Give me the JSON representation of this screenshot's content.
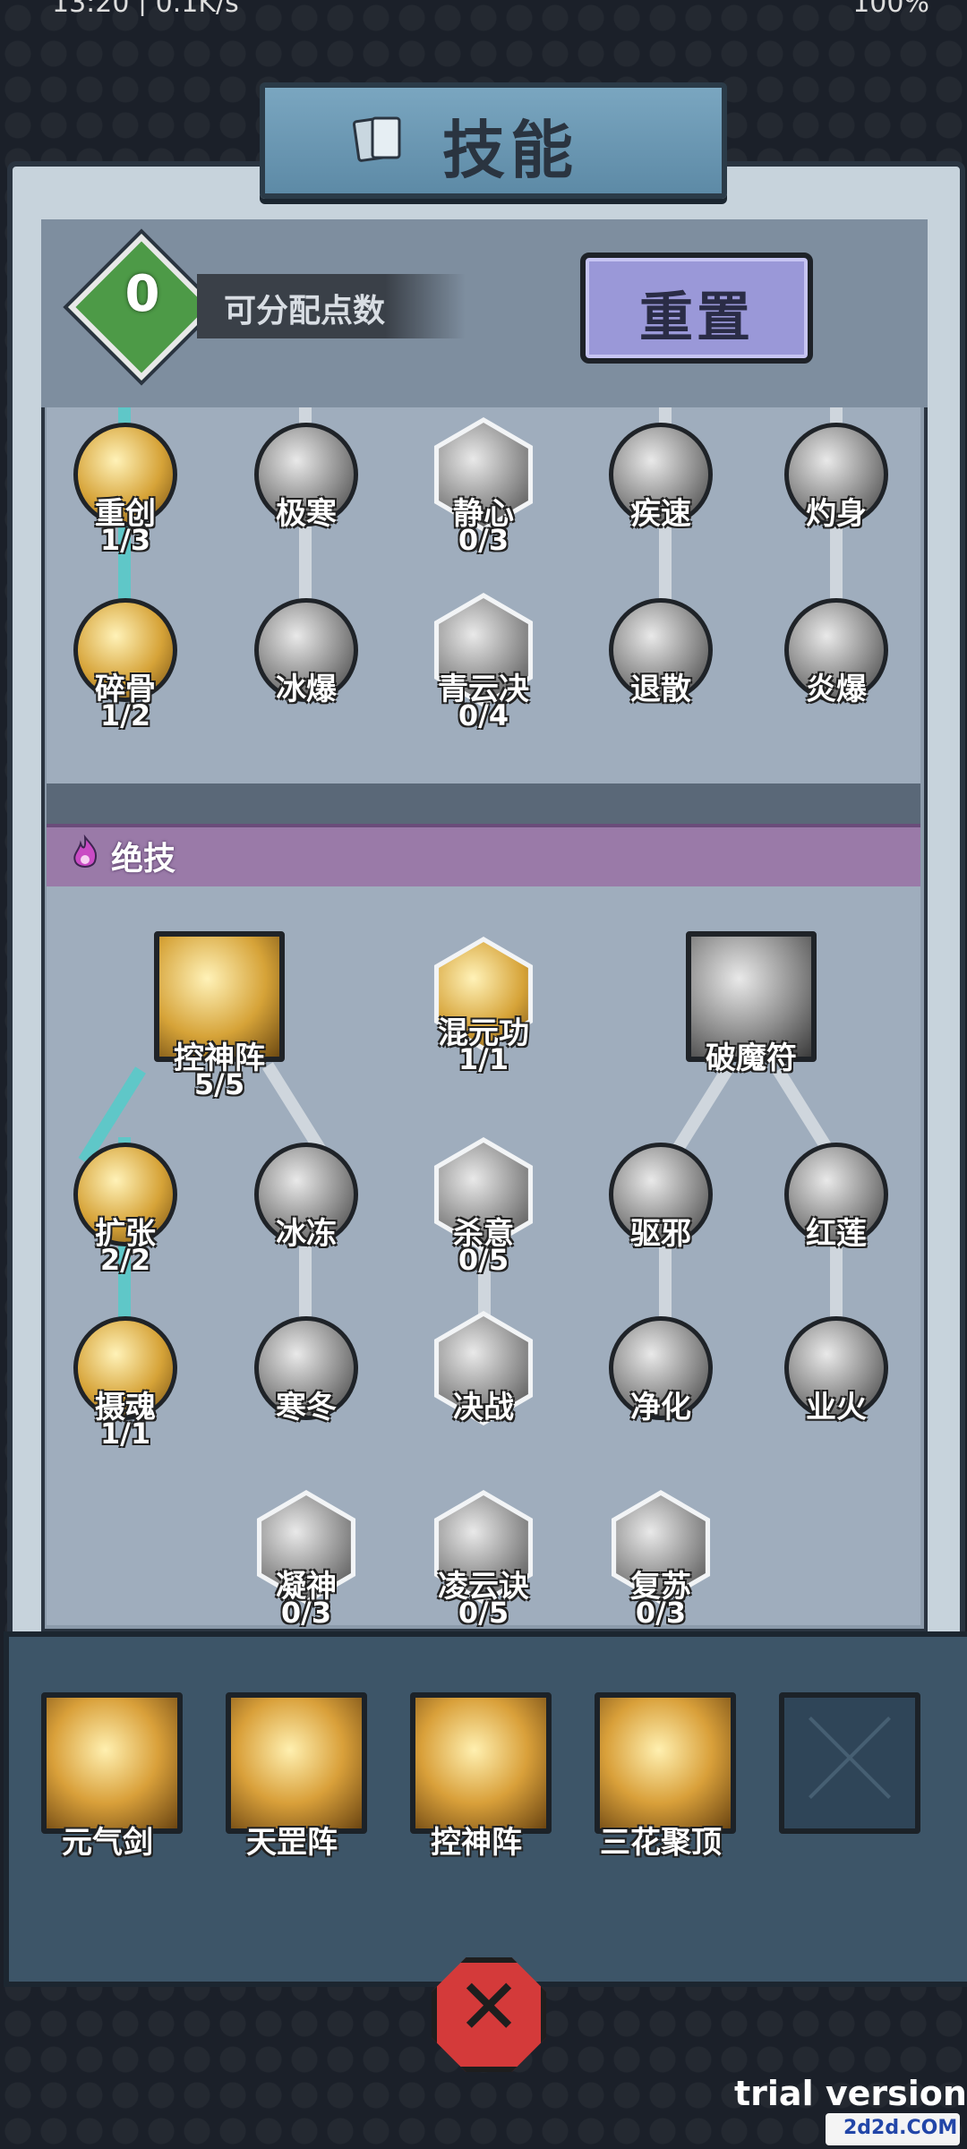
{
  "status_bar": {
    "left": "13:20 | 0.1K/s",
    "right": "100%"
  },
  "header": {
    "title": "技能"
  },
  "points": {
    "value": "0",
    "label": "可分配点数"
  },
  "reset_button": {
    "label": "重置"
  },
  "basic_skills": [
    {
      "name": "重创",
      "level": "1/3"
    },
    {
      "name": "极寒",
      "level": ""
    },
    {
      "name": "静心",
      "level": "0/3"
    },
    {
      "name": "疾速",
      "level": ""
    },
    {
      "name": "灼身",
      "level": ""
    },
    {
      "name": "碎骨",
      "level": "1/2"
    },
    {
      "name": "冰爆",
      "level": ""
    },
    {
      "name": "青云决",
      "level": "0/4"
    },
    {
      "name": "退散",
      "level": ""
    },
    {
      "name": "炎爆",
      "level": ""
    }
  ],
  "ultimate_section": {
    "label": "绝技"
  },
  "ultimate_skills": [
    {
      "name": "控神阵",
      "level": "5/5"
    },
    {
      "name": "混元功",
      "level": "1/1"
    },
    {
      "name": "破魔符",
      "level": ""
    },
    {
      "name": "扩张",
      "level": "2/2"
    },
    {
      "name": "冰冻",
      "level": ""
    },
    {
      "name": "杀意",
      "level": "0/5"
    },
    {
      "name": "驱邪",
      "level": ""
    },
    {
      "name": "红莲",
      "level": ""
    },
    {
      "name": "摄魂",
      "level": "1/1"
    },
    {
      "name": "寒冬",
      "level": ""
    },
    {
      "name": "决战",
      "level": ""
    },
    {
      "name": "净化",
      "level": ""
    },
    {
      "name": "业火",
      "level": ""
    },
    {
      "name": "凝神",
      "level": "0/3"
    },
    {
      "name": "凌云诀",
      "level": "0/5"
    },
    {
      "name": "复苏",
      "level": "0/3"
    }
  ],
  "equipped": [
    {
      "name": "元气剑"
    },
    {
      "name": "天罡阵"
    },
    {
      "name": "控神阵"
    },
    {
      "name": "三花聚顶"
    },
    {
      "name": ""
    }
  ],
  "footer": {
    "trial": "trial version",
    "watermark": "2d2d.COM"
  },
  "colors": {
    "accent_line": "#5fc7c8",
    "points_badge": "#4d9a47",
    "reset": "#9a98d8",
    "ultimate_bar": "#9a7aa8"
  }
}
